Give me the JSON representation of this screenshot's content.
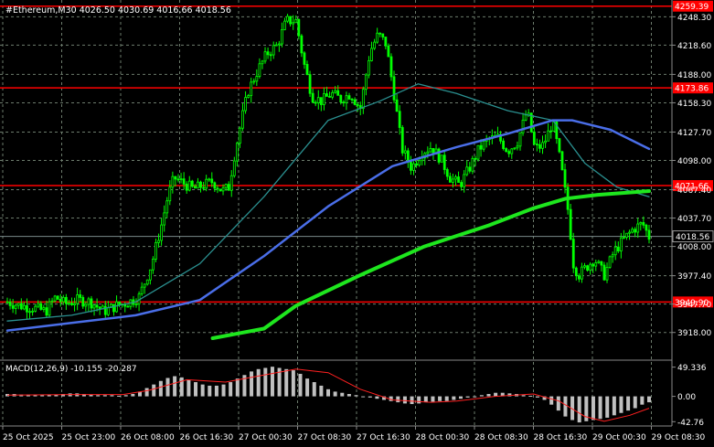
{
  "header": {
    "symbol_line": "#Ethereum,M30  4026.50 4030.69 4016.66 4018.56"
  },
  "macd": {
    "label": "MACD(12,26,9) -10.155 -20.287",
    "scale_labels": [
      "49.336",
      "0.00",
      "-42.76"
    ]
  },
  "colors": {
    "background": "#000000",
    "bull_candle": "#00ff00",
    "level_line": "#ff0000",
    "ma_fast": "#2a8f8f",
    "ma_mid": "#4a6ee8",
    "ma_slow": "#1ee61e",
    "macd_hist": "#c0c0c0",
    "macd_signal": "#ff2020",
    "grid": "#6c7b6c"
  },
  "chart_data": {
    "type": "candlestick",
    "y_axis_labels": [
      "4248.30",
      "4218.60",
      "4188.00",
      "4158.30",
      "4127.70",
      "4098.00",
      "4067.40",
      "4037.70",
      "4008.00",
      "3977.40",
      "3947.70",
      "3918.00"
    ],
    "ylim": [
      3912,
      4262
    ],
    "price_label": "4018.56",
    "current_price": 4018.56,
    "levels": [
      {
        "label": "4259.39",
        "value": 4259.39
      },
      {
        "label": "4173.86",
        "value": 4173.86
      },
      {
        "label": "4071.66",
        "value": 4071.66
      },
      {
        "label": "3949.90",
        "value": 3949.9
      }
    ],
    "x_axis_labels": [
      "25 Oct 2025",
      "25 Oct 23:00",
      "26 Oct 08:00",
      "26 Oct 16:30",
      "27 Oct 00:30",
      "27 Oct 08:30",
      "27 Oct 16:30",
      "28 Oct 00:30",
      "28 Oct 08:30",
      "28 Oct 16:30",
      "29 Oct 00:30",
      "29 Oct 08:30"
    ],
    "price_path": [
      [
        0,
        3950
      ],
      [
        0.02,
        3946
      ],
      [
        0.04,
        3944
      ],
      [
        0.06,
        3940
      ],
      [
        0.075,
        3955
      ],
      [
        0.09,
        3948
      ],
      [
        0.11,
        3952
      ],
      [
        0.13,
        3950
      ],
      [
        0.15,
        3940
      ],
      [
        0.17,
        3946
      ],
      [
        0.19,
        3950
      ],
      [
        0.205,
        3955
      ],
      [
        0.215,
        3972
      ],
      [
        0.225,
        3990
      ],
      [
        0.24,
        4030
      ],
      [
        0.25,
        4060
      ],
      [
        0.26,
        4080
      ],
      [
        0.275,
        4074
      ],
      [
        0.29,
        4068
      ],
      [
        0.305,
        4072
      ],
      [
        0.32,
        4076
      ],
      [
        0.335,
        4066
      ],
      [
        0.345,
        4070
      ],
      [
        0.355,
        4108
      ],
      [
        0.365,
        4140
      ],
      [
        0.375,
        4170
      ],
      [
        0.39,
        4192
      ],
      [
        0.405,
        4210
      ],
      [
        0.42,
        4218
      ],
      [
        0.435,
        4244
      ],
      [
        0.45,
        4244
      ],
      [
        0.462,
        4200
      ],
      [
        0.475,
        4165
      ],
      [
        0.49,
        4160
      ],
      [
        0.505,
        4168
      ],
      [
        0.52,
        4162
      ],
      [
        0.535,
        4168
      ],
      [
        0.55,
        4152
      ],
      [
        0.565,
        4212
      ],
      [
        0.578,
        4230
      ],
      [
        0.59,
        4220
      ],
      [
        0.602,
        4170
      ],
      [
        0.615,
        4110
      ],
      [
        0.63,
        4090
      ],
      [
        0.645,
        4106
      ],
      [
        0.66,
        4112
      ],
      [
        0.675,
        4100
      ],
      [
        0.69,
        4080
      ],
      [
        0.705,
        4072
      ],
      [
        0.72,
        4090
      ],
      [
        0.735,
        4110
      ],
      [
        0.75,
        4120
      ],
      [
        0.765,
        4122
      ],
      [
        0.78,
        4108
      ],
      [
        0.795,
        4118
      ],
      [
        0.81,
        4150
      ],
      [
        0.822,
        4110
      ],
      [
        0.835,
        4114
      ],
      [
        0.85,
        4138
      ],
      [
        0.862,
        4096
      ],
      [
        0.875,
        4040
      ],
      [
        0.882,
        3990
      ],
      [
        0.89,
        3978
      ],
      [
        0.9,
        3985
      ],
      [
        0.915,
        3995
      ],
      [
        0.93,
        3978
      ],
      [
        0.945,
        4002
      ],
      [
        0.96,
        4015
      ],
      [
        0.975,
        4026
      ],
      [
        0.99,
        4032
      ],
      [
        1,
        4018
      ]
    ],
    "moving_averages": [
      {
        "color_key": "ma_fast",
        "path": [
          [
            0,
            3930
          ],
          [
            0.1,
            3936
          ],
          [
            0.2,
            3950
          ],
          [
            0.3,
            3990
          ],
          [
            0.4,
            4060
          ],
          [
            0.5,
            4140
          ],
          [
            0.58,
            4160
          ],
          [
            0.64,
            4178
          ],
          [
            0.7,
            4168
          ],
          [
            0.78,
            4150
          ],
          [
            0.85,
            4140
          ],
          [
            0.9,
            4095
          ],
          [
            0.95,
            4070
          ],
          [
            1,
            4060
          ]
        ]
      },
      {
        "color_key": "ma_mid",
        "path": [
          [
            0,
            3920
          ],
          [
            0.1,
            3928
          ],
          [
            0.2,
            3936
          ],
          [
            0.3,
            3952
          ],
          [
            0.4,
            3998
          ],
          [
            0.5,
            4050
          ],
          [
            0.6,
            4092
          ],
          [
            0.7,
            4112
          ],
          [
            0.78,
            4126
          ],
          [
            0.85,
            4140
          ],
          [
            0.88,
            4140
          ],
          [
            0.94,
            4130
          ],
          [
            1,
            4110
          ]
        ]
      },
      {
        "color_key": "ma_slow",
        "path": [
          [
            0.32,
            3912
          ],
          [
            0.4,
            3922
          ],
          [
            0.45,
            3946
          ],
          [
            0.55,
            3978
          ],
          [
            0.65,
            4008
          ],
          [
            0.75,
            4030
          ],
          [
            0.82,
            4048
          ],
          [
            0.87,
            4058
          ],
          [
            0.92,
            4062
          ],
          [
            1,
            4066
          ]
        ]
      }
    ],
    "macd_hist": [
      4,
      4,
      3,
      3,
      2,
      2,
      3,
      3,
      4,
      5,
      5,
      4,
      3,
      2,
      2,
      2,
      1,
      2,
      4,
      8,
      14,
      20,
      26,
      31,
      34,
      32,
      28,
      24,
      20,
      18,
      18,
      20,
      24,
      30,
      36,
      42,
      46,
      48,
      50,
      48,
      46,
      44,
      38,
      30,
      24,
      18,
      12,
      8,
      6,
      4,
      2,
      0,
      -2,
      -4,
      -6,
      -8,
      -10,
      -12,
      -13,
      -12,
      -10,
      -9,
      -8,
      -8,
      -6,
      -4,
      -2,
      0,
      2,
      4,
      6,
      6,
      5,
      4,
      2,
      1,
      -2,
      -6,
      -14,
      -24,
      -34,
      -40,
      -44,
      -42,
      -40,
      -38,
      -36,
      -32,
      -28,
      -24,
      -20,
      -14,
      -10
    ],
    "macd_signal": [
      [
        0,
        2
      ],
      [
        0.1,
        3
      ],
      [
        0.18,
        3
      ],
      [
        0.22,
        10
      ],
      [
        0.28,
        28
      ],
      [
        0.34,
        24
      ],
      [
        0.4,
        36
      ],
      [
        0.45,
        46
      ],
      [
        0.5,
        40
      ],
      [
        0.55,
        12
      ],
      [
        0.6,
        -6
      ],
      [
        0.66,
        -10
      ],
      [
        0.7,
        -8
      ],
      [
        0.76,
        0
      ],
      [
        0.82,
        4
      ],
      [
        0.86,
        -8
      ],
      [
        0.9,
        -34
      ],
      [
        0.93,
        -42
      ],
      [
        0.97,
        -32
      ],
      [
        1,
        -20
      ]
    ],
    "macd_ylim": [
      -50,
      58
    ]
  }
}
